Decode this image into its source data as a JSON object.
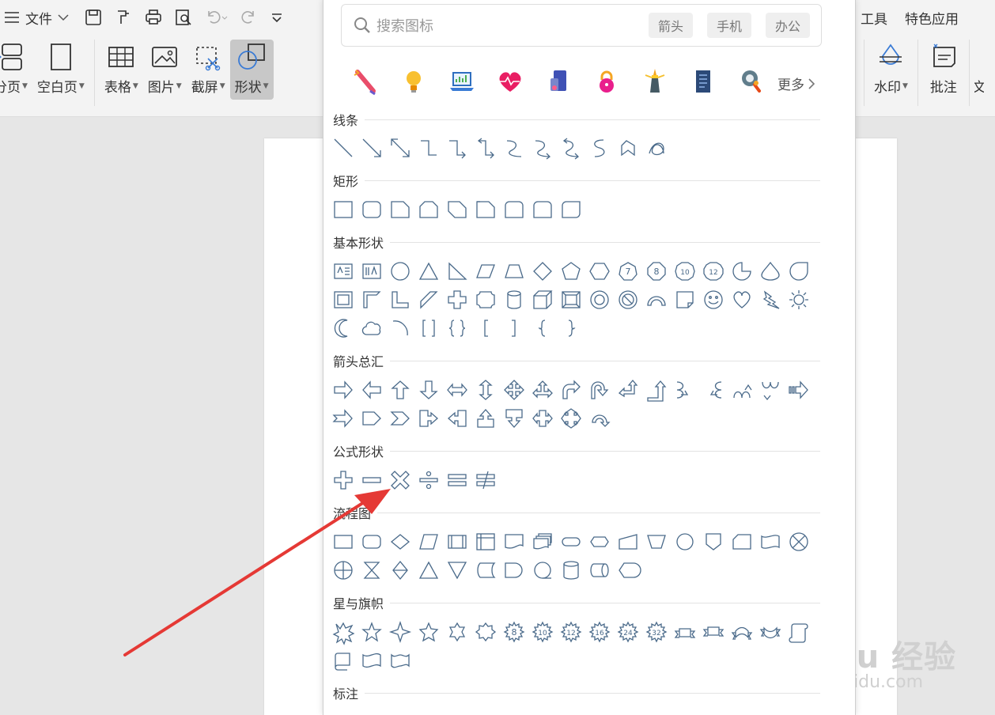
{
  "app": {
    "menu_label": "文件",
    "ribbon": [
      {
        "label": "分页",
        "icon": "page-break-icon"
      },
      {
        "label": "空白页",
        "icon": "blank-page-icon"
      },
      {
        "label": "表格",
        "icon": "table-icon"
      },
      {
        "label": "图片",
        "icon": "picture-icon"
      },
      {
        "label": "截屏",
        "icon": "screenshot-icon"
      },
      {
        "label": "形状",
        "icon": "shapes-icon"
      }
    ],
    "ribbon_right": [
      {
        "label": "水印",
        "icon": "watermark-icon"
      },
      {
        "label": "批注",
        "icon": "comment-icon"
      },
      {
        "label": "文",
        "icon": ""
      }
    ],
    "tabs_right": [
      "工具",
      "特色应用"
    ]
  },
  "panel": {
    "search_placeholder": "搜索图标",
    "search_tags": [
      "箭头",
      "手机",
      "办公"
    ],
    "more_label": "更多",
    "featured_icons": [
      "firework-icon",
      "lightbulb-icon",
      "laptop-chart-icon",
      "heart-pulse-icon",
      "phone-book-icon",
      "lock-icon",
      "lighthouse-icon",
      "document-icon",
      "magnifier-gear-icon"
    ],
    "sections": {
      "lines": "线条",
      "rect": "矩形",
      "basic": "基本形状",
      "arrows": "箭头总汇",
      "formula": "公式形状",
      "flow": "流程图",
      "stars": "星与旗帜",
      "callout": "标注"
    }
  },
  "watermark": {
    "brand": "Bai du 经验",
    "url": "jingyan.baidu.com"
  },
  "colors": {
    "accent_arrow": "#e53935",
    "shape_stroke": "#4a6a8a"
  }
}
